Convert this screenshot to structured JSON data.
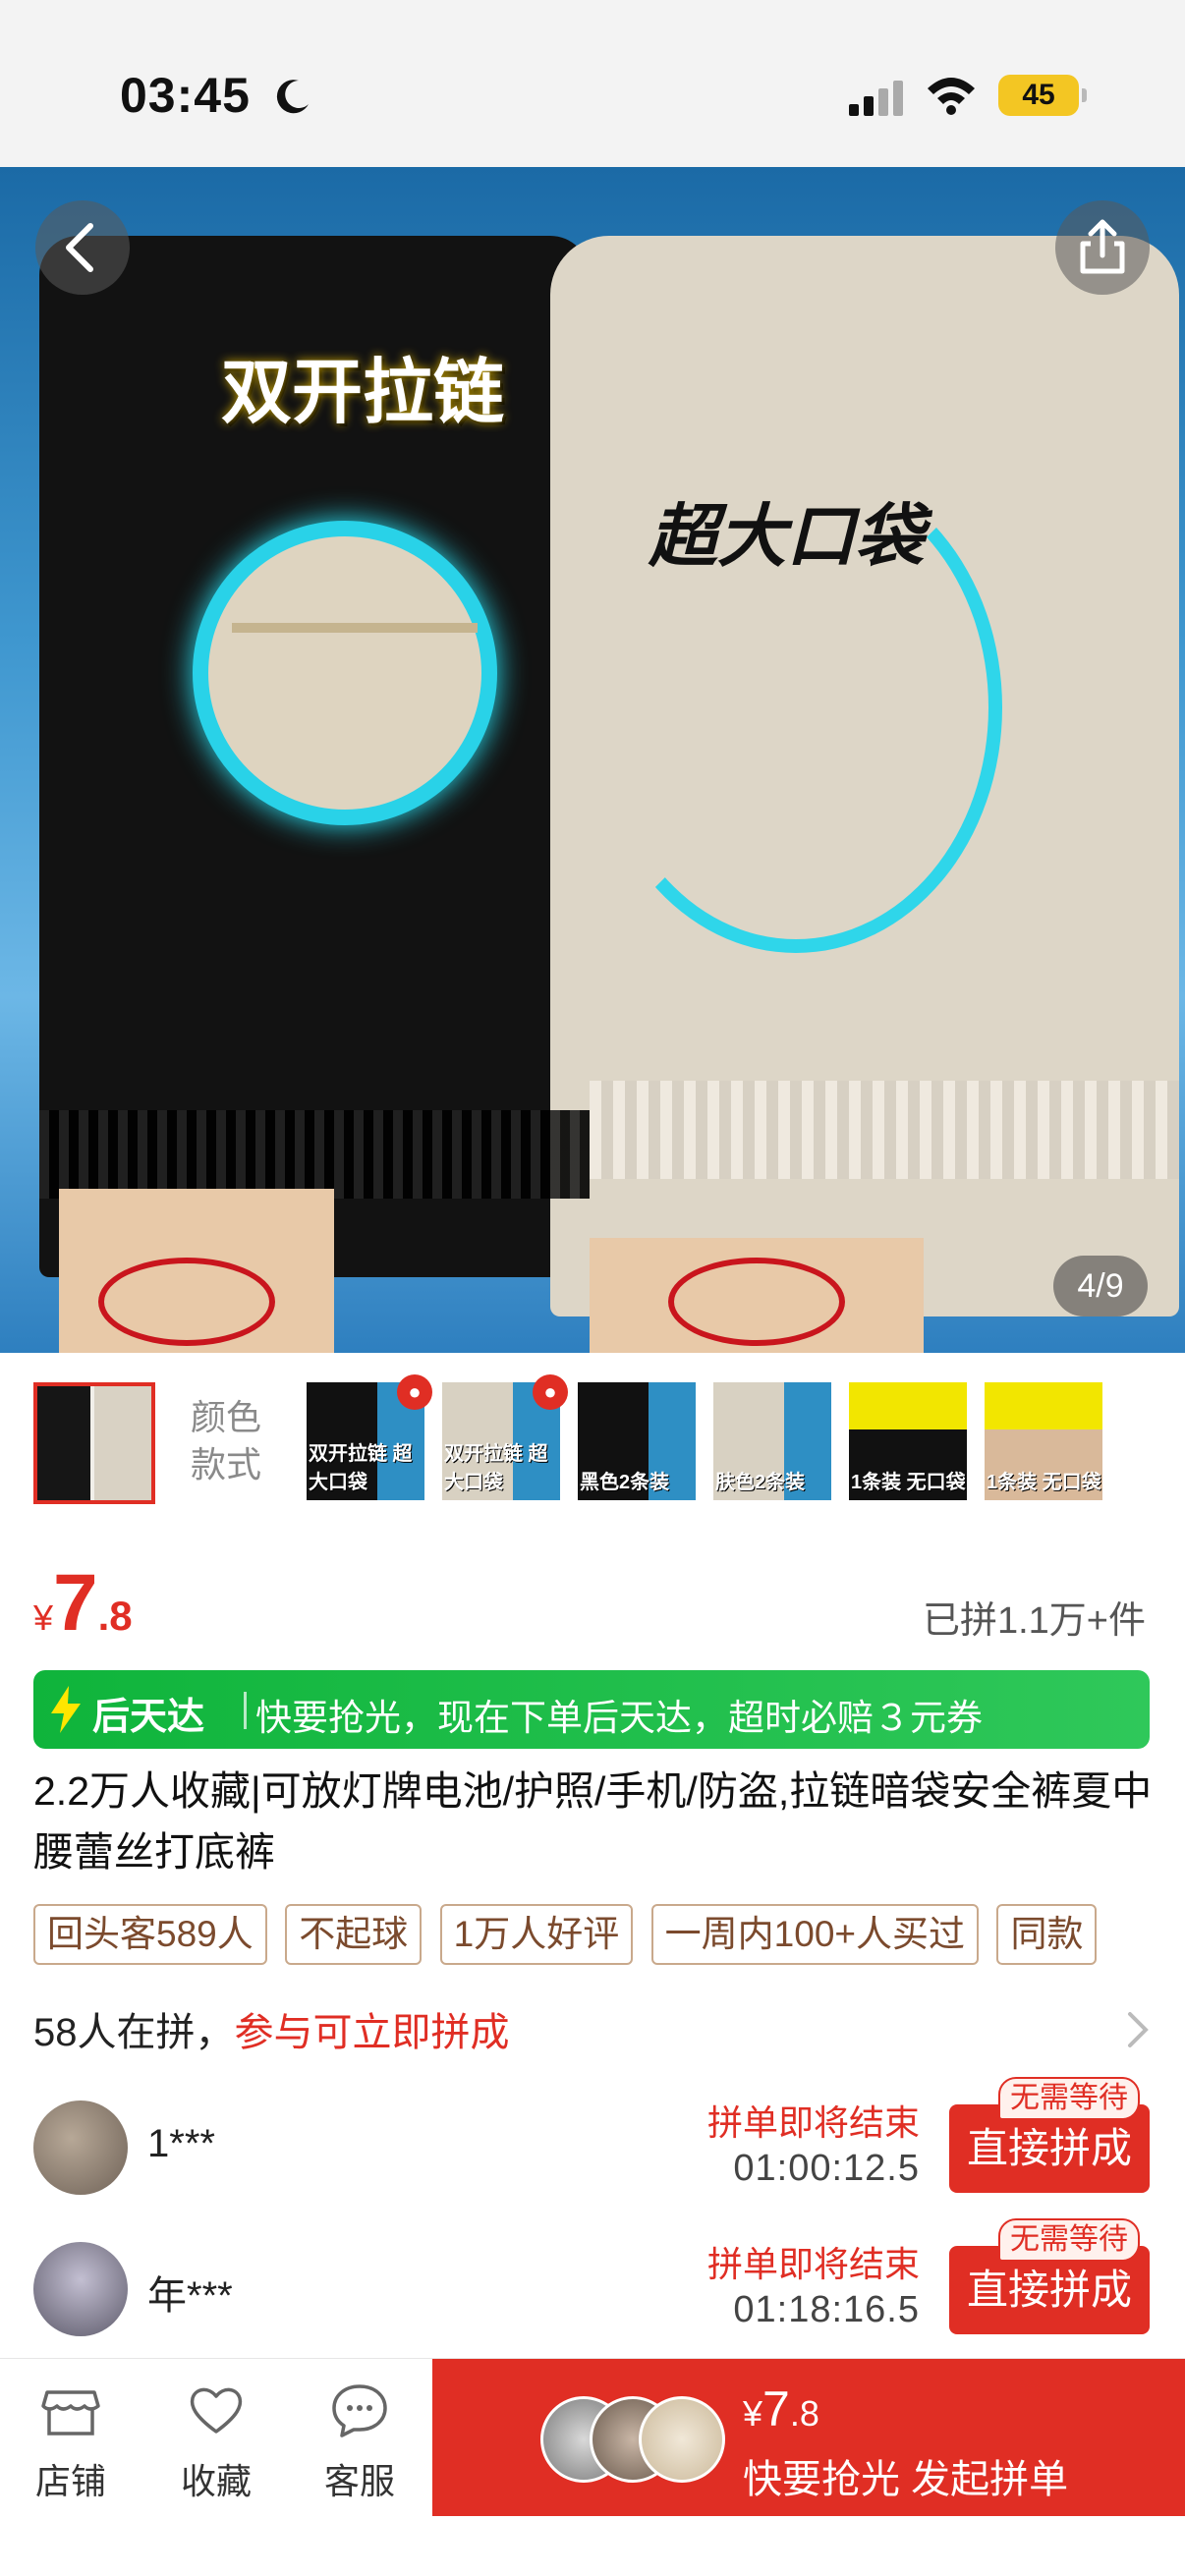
{
  "status_bar": {
    "time": "03:45",
    "battery": "45"
  },
  "gallery": {
    "overlay_text_1": "双开拉链",
    "overlay_text_2": "超大口袋",
    "page_indicator": "4/9"
  },
  "variants": {
    "label_line1": "颜色",
    "label_line2": "款式",
    "thumbs": [
      {
        "text": "双开拉链 超大口袋"
      },
      {
        "text": "双开拉链 超大口袋"
      },
      {
        "text": "黑色2条装"
      },
      {
        "text": "肤色2条装"
      },
      {
        "text": "1条装 无口袋"
      },
      {
        "text": "1条装 无口袋"
      }
    ]
  },
  "price": {
    "symbol": "¥",
    "integer": "7",
    "decimal": ".8",
    "sold": "已拼1.1万+件"
  },
  "banner": {
    "tag": "后天达",
    "text": "快要抢光，现在下单后天达，超时必赔３元券"
  },
  "product": {
    "title": "2.2万人收藏|可放灯牌电池/护照/手机/防盗,拉链暗袋安全裤夏中腰蕾丝打底裤"
  },
  "tags": [
    "回头客589人",
    "不起球",
    "1万人好评",
    "一周内100+人买过",
    "同款"
  ],
  "group": {
    "count_text": "58人在拼，",
    "cta_text": "参与可立即拼成",
    "members": [
      {
        "name": "1***",
        "status": "拼单即将结束",
        "countdown": "01:00:12.5",
        "badge": "无需等待",
        "button": "直接拼成"
      },
      {
        "name": "年***",
        "status": "拼单即将结束",
        "countdown": "01:18:16.5",
        "badge": "无需等待",
        "button": "直接拼成"
      }
    ]
  },
  "bottom_bar": {
    "store": "店铺",
    "favorite": "收藏",
    "service": "客服",
    "cta_symbol": "¥",
    "cta_price_int": "7",
    "cta_price_dec": ".8",
    "cta_label": "快要抢光 发起拼单"
  },
  "colors": {
    "accent_red": "#e02e24",
    "banner_green": "#0fb43b",
    "tag_brown": "#7b4a2d"
  }
}
